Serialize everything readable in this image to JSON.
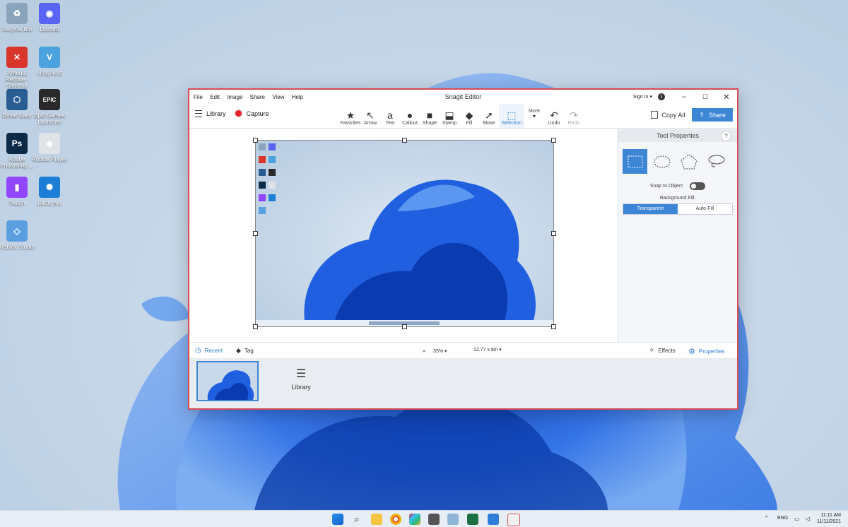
{
  "desktop": {
    "icons": [
      {
        "label": "Recycle Bin",
        "glyph": "♻",
        "color": "#8aa4bd"
      },
      {
        "label": "Discord",
        "glyph": "◉",
        "color": "#5865f2"
      },
      {
        "label": "XMedia Recode - Shortcut",
        "glyph": "✕",
        "color": "#d9352a"
      },
      {
        "label": "vRayNext",
        "glyph": "V",
        "color": "#4aa3df"
      },
      {
        "label": "Driver Easy",
        "glyph": "⬡",
        "color": "#2a5c94"
      },
      {
        "label": "Epic Games Launcher",
        "glyph": "EPIC",
        "color": "#2a2a2a"
      },
      {
        "label": "Adobe Photoshop ...",
        "glyph": "Ps",
        "color": "#0b2a48"
      },
      {
        "label": "Roblox Player",
        "glyph": "◆",
        "color": "#dfe3e8"
      },
      {
        "label": "Twitch",
        "glyph": "▮",
        "color": "#9146ff"
      },
      {
        "label": "Battle.net",
        "glyph": "✺",
        "color": "#1c7ed6"
      },
      {
        "label": "Roblox Studio",
        "glyph": "◇",
        "color": "#5aa0e0"
      }
    ]
  },
  "window": {
    "title": "Snagit Editor",
    "menu": [
      "File",
      "Edit",
      "Image",
      "Share",
      "View",
      "Help"
    ],
    "sign_in": "Sign In ▾",
    "info_glyph": "i",
    "controls": {
      "minimize": "–",
      "maximize": "☐",
      "close": "✕"
    }
  },
  "toolbar": {
    "library": "Library",
    "capture": "Capture",
    "tools": [
      {
        "label": "Favorites",
        "glyph": "★"
      },
      {
        "label": "Arrow",
        "glyph": "↖"
      },
      {
        "label": "Text",
        "glyph": "a"
      },
      {
        "label": "Callout",
        "glyph": "●"
      },
      {
        "label": "Shape",
        "glyph": "■"
      },
      {
        "label": "Stamp",
        "glyph": "⬓"
      },
      {
        "label": "Fill",
        "glyph": "◆"
      },
      {
        "label": "Move",
        "glyph": "➚"
      },
      {
        "label": "Selection",
        "glyph": "⬚"
      },
      {
        "label": "More",
        "glyph": "▾"
      },
      {
        "label": "Undo",
        "glyph": "↶"
      },
      {
        "label": "Redo",
        "glyph": "↷"
      }
    ],
    "copy_all": "Copy All",
    "share": "Share"
  },
  "properties": {
    "header": "Tool Properties",
    "help": "?",
    "snap_to_object": "Snap to Object",
    "background_fill": "Background Fill:",
    "fill_options": [
      "Transparent",
      "Auto-Fill"
    ],
    "selected_fill": "Transparent"
  },
  "statusbar": {
    "recent": "Recent",
    "tag": "Tag",
    "zoom": "35% ▾",
    "size": "12.77 x 8in ▾",
    "effects": "Effects",
    "properties": "Properties"
  },
  "tray": {
    "library": "Library"
  },
  "taskbar": {
    "language": "ENG",
    "time": "11:11 AM",
    "date": "11/11/2021",
    "up_arrow": "^"
  }
}
